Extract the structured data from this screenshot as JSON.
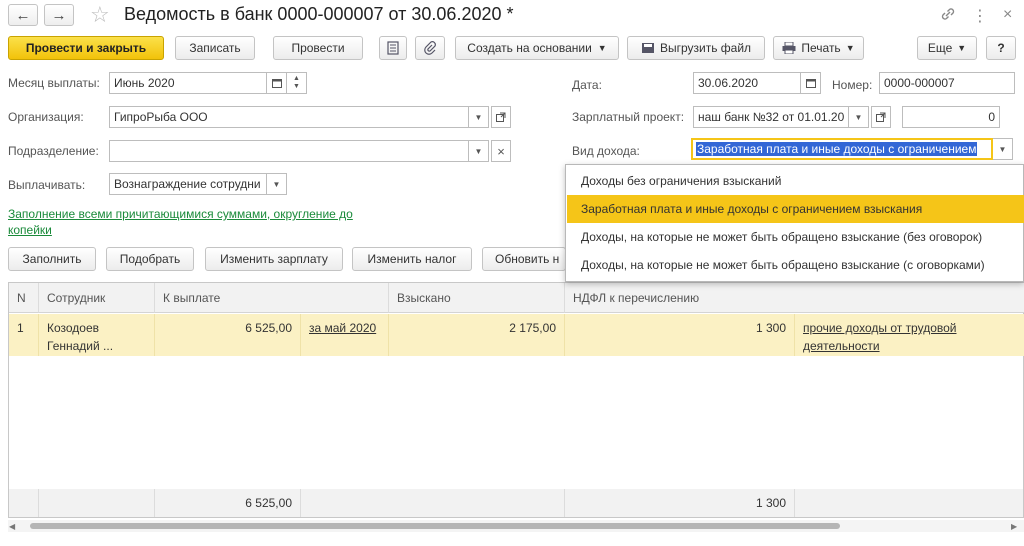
{
  "window": {
    "title": "Ведомость в банк 0000-000007 от 30.06.2020 *",
    "back_icon": "←",
    "forward_icon": "→",
    "star_icon": "☆",
    "link_icon": "🔗",
    "menu_icon": "⋮",
    "maximize_icon": "□",
    "close_icon": "×"
  },
  "toolbar": {
    "post_close": "Провести и закрыть",
    "save": "Записать",
    "post": "Провести",
    "create_based": "Создать на основании",
    "export_file": "Выгрузить файл",
    "print": "Печать",
    "more": "Еще",
    "help": "?"
  },
  "form": {
    "month_label": "Месяц выплаты:",
    "month_value": "Июнь 2020",
    "org_label": "Организация:",
    "org_value": "ГипроРыба ООО",
    "dept_label": "Подразделение:",
    "dept_value": "",
    "pay_label": "Выплачивать:",
    "pay_value": "Вознаграждение сотрудни",
    "date_label": "Дата:",
    "date_value": "30.06.2020",
    "number_label": "Номер:",
    "number_value": "0000-000007",
    "project_label": "Зарплатный проект:",
    "project_value": "наш банк №32 от 01.01.20",
    "project_amount": "0",
    "income_label": "Вид дохода:",
    "income_value": "Заработная плата и иные доходы с ограничением",
    "fill_link": "Заполнение всеми причитающимися суммами, округление до копейки"
  },
  "actions": {
    "fill": "Заполнить",
    "pick": "Подобрать",
    "change_salary": "Изменить зарплату",
    "change_tax": "Изменить налог",
    "refresh": "Обновить н"
  },
  "table": {
    "headers": [
      "N",
      "Сотрудник",
      "К выплате",
      "Взыскано",
      "НДФЛ к перечислению"
    ],
    "rows": [
      {
        "n": "1",
        "employee": "Козодоев Геннадий ...",
        "to_pay": "6 525,00",
        "period": "за май 2020",
        "withheld": "2 175,00",
        "ndfl": "1 300",
        "income_type": "прочие доходы от трудовой деятельности"
      }
    ],
    "totals": {
      "to_pay": "6 525,00",
      "ndfl": "1 300"
    }
  },
  "dropdown": {
    "items": [
      "Доходы без ограничения взысканий",
      "Заработная плата и иные доходы с ограничением взыскания",
      "Доходы, на которые не может быть обращено взыскание (без оговорок)",
      "Доходы, на которые не может быть обращено взыскание (с оговорками)"
    ],
    "selected_index": 1
  },
  "colors": {
    "accent": "#f5c518",
    "row_highlight": "#fbf1c4",
    "link_green": "#1a8a3a"
  }
}
